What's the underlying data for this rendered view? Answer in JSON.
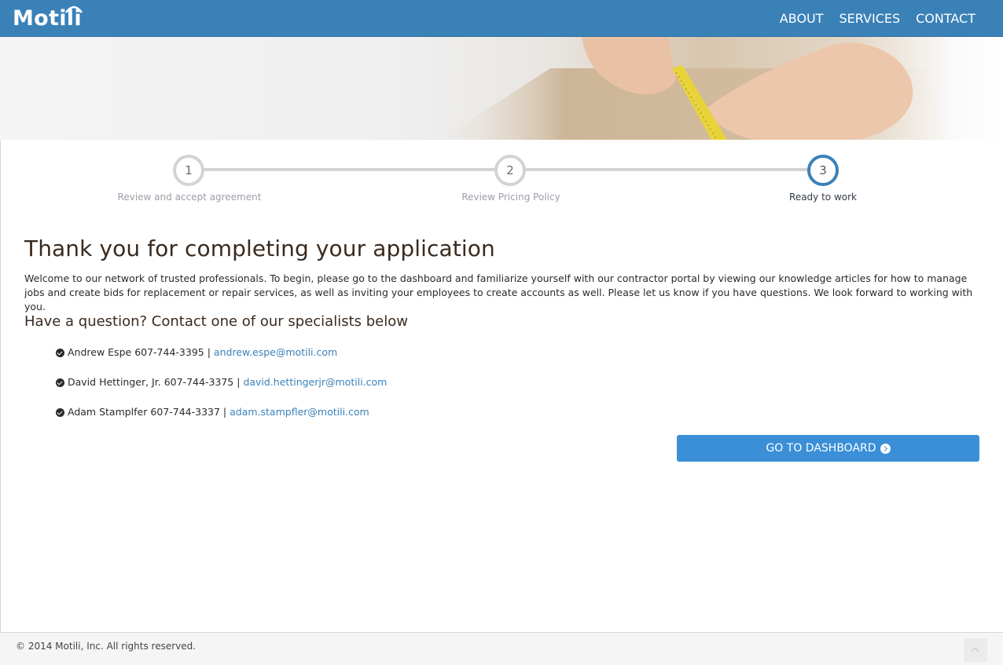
{
  "header": {
    "logo_text": "Motili",
    "nav": [
      {
        "label": "ABOUT"
      },
      {
        "label": "SERVICES"
      },
      {
        "label": "CONTACT"
      }
    ]
  },
  "stepper": {
    "current_step": 3,
    "steps": [
      {
        "number": "1",
        "label": "Review and accept agreement"
      },
      {
        "number": "2",
        "label": "Review Pricing Policy"
      },
      {
        "number": "3",
        "label": "Ready to work"
      }
    ]
  },
  "content": {
    "title": "Thank you for completing your application",
    "intro": "Welcome to our network of trusted professionals. To begin, please go to the dashboard and familiarize yourself with our contractor portal by viewing our knowledge articles for how to manage jobs and create bids for replacement or repair services, as well as inviting your employees to create accounts as well. Please let us know if you have questions. We look forward to working with you.",
    "subtitle": "Have a question? Contact one of our specialists below",
    "specialists": [
      {
        "name": "Andrew Espe",
        "phone": "607-744-3395",
        "email": "andrew.espe@motili.com"
      },
      {
        "name": "David Hettinger, Jr.",
        "phone": "607-744-3375",
        "email": "david.hettingerjr@motili.com"
      },
      {
        "name": "Adam Stamplfer",
        "phone": "607-744-3337",
        "email": "adam.stampfler@motili.com"
      }
    ],
    "dashboard_button": "GO TO DASHBOARD"
  },
  "footer": {
    "copyright": "© 2014 Motili, Inc. All rights reserved."
  },
  "colors": {
    "brand_blue": "#3a81b8",
    "button_blue": "#3a8fd6",
    "link_blue": "#3a81b8"
  }
}
